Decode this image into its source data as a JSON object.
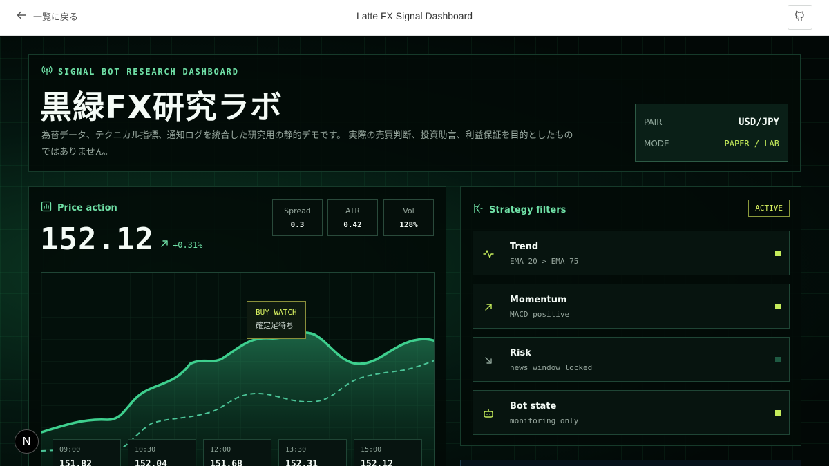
{
  "topbar": {
    "back_label": "一覧に戻る",
    "title": "Latte FX Signal Dashboard",
    "github_icon": "github-icon"
  },
  "hero": {
    "eyebrow": "SIGNAL BOT RESEARCH DASHBOARD",
    "title": "黒緑FX研究ラボ",
    "description": "為替データ、テクニカル指標、通知ログを統合した研究用の静的デモです。 実際の売買判断、投資助言、利益保証を目的としたものではありません。",
    "pair_label": "PAIR",
    "pair_value": "USD/JPY",
    "mode_label": "MODE",
    "mode_value": "PAPER / LAB"
  },
  "price": {
    "heading": "Price action",
    "value": "152.12",
    "change": "+0.31%",
    "metrics": [
      {
        "label": "Spread",
        "value": "0.3"
      },
      {
        "label": "ATR",
        "value": "0.42"
      },
      {
        "label": "Vol",
        "value": "128%"
      }
    ],
    "tooltip": {
      "title": "BUY WATCH",
      "subtitle": "確定足待ち"
    },
    "ticks": [
      {
        "time": "09:00",
        "price": "151.82"
      },
      {
        "time": "10:30",
        "price": "152.04"
      },
      {
        "time": "12:00",
        "price": "151.68"
      },
      {
        "time": "13:30",
        "price": "152.31"
      },
      {
        "time": "15:00",
        "price": "152.12"
      }
    ]
  },
  "strategy": {
    "heading": "Strategy filters",
    "badge": "ACTIVE",
    "filters": [
      {
        "name": "Trend",
        "desc": "EMA 20 > EMA 75",
        "icon": "activity-icon",
        "state": "on"
      },
      {
        "name": "Momentum",
        "desc": "MACD positive",
        "icon": "arrow-up-right-icon",
        "state": "on"
      },
      {
        "name": "Risk",
        "desc": "news window locked",
        "icon": "arrow-down-right-icon",
        "state": "off"
      },
      {
        "name": "Bot state",
        "desc": "monitoring only",
        "icon": "bot-icon",
        "state": "on"
      }
    ]
  },
  "colors": {
    "accent": "#6fe0a6",
    "highlight": "#d7f060",
    "line": "#3ecf8e",
    "status_on": "#c5ec5b",
    "status_off": "#1e5a42"
  },
  "footer": {
    "badge": "N"
  }
}
